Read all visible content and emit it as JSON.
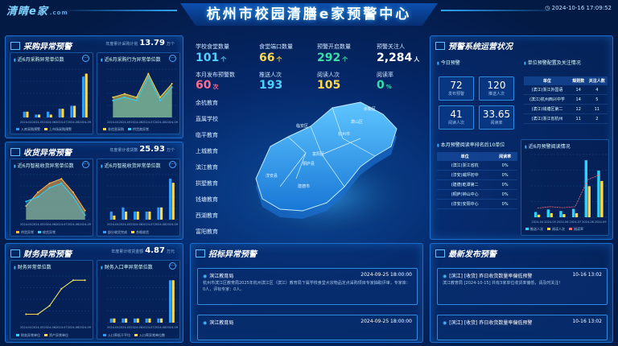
{
  "header": {
    "logo": "清睛e家",
    "logo_small": ".com",
    "title": "杭州市校园清膳e家预警中心",
    "datetime": "2024-10-16 17:09:52"
  },
  "purchase": {
    "title": "采购异常预警",
    "stat_label": "年度累计采购计划",
    "stat_value": "13.79",
    "stat_unit": "万个",
    "chart1": {
      "title": "近6月采购异常单位数",
      "legend": [
        "入库采购预警",
        "上市场采购预警"
      ]
    },
    "chart2": {
      "title": "近6月采购行为异常单位数",
      "legend": [
        "非信息采购",
        "供货商异常"
      ]
    }
  },
  "income": {
    "title": "收货异常预警",
    "stat_label": "年度累计收货数",
    "stat_value": "25.93",
    "stat_unit": "万个",
    "chart1": {
      "title": "近6月智能收货异常单位数",
      "legend": [
        "供货异常",
        "收货异常"
      ]
    },
    "chart2": {
      "title": "近6月智能收货异常单位数",
      "legend": [
        "部分收货完成",
        "合格收货"
      ]
    }
  },
  "finance": {
    "title": "财务异常预警",
    "stat_label": "年度累计收货金额",
    "stat_value": "4.87",
    "stat_unit": "万元",
    "chart1": {
      "title": "财务异常单位数",
      "legend": [
        "财务异常单位",
        "资产异常单位"
      ]
    },
    "chart2": {
      "title": "财务入口率异常单位数",
      "legend": [
        "入口率低于平均",
        "入口率异常单位数"
      ]
    }
  },
  "kpis": [
    {
      "label": "学校食堂数量",
      "value": "101",
      "unit": "个",
      "color": "#4fd1ff"
    },
    {
      "label": "食堂端口数量",
      "value": "66",
      "unit": "个",
      "color": "#ffd84a"
    },
    {
      "label": "预警开启数量",
      "value": "292",
      "unit": "个",
      "color": "#37e0a6"
    },
    {
      "label": "预警关注人",
      "value": "2,284",
      "unit": "人",
      "color": "#ffffff"
    },
    {
      "label": "本月发布预警数",
      "value": "60",
      "unit": "次",
      "color": "#ff6b8e"
    },
    {
      "label": "推送人次",
      "value": "193",
      "unit": "",
      "color": "#4fd1ff"
    },
    {
      "label": "阅读人次",
      "value": "105",
      "unit": "",
      "color": "#ffd84a"
    },
    {
      "label": "阅读率",
      "value": "0",
      "unit": "%",
      "color": "#37e0a6"
    }
  ],
  "districts": [
    "余杭教育",
    "直属学校",
    "临平教育",
    "上城教育",
    "滨江教育",
    "拱墅教育",
    "钱塘教育",
    "西湖教育",
    "富阳教育"
  ],
  "map_labels": [
    "临安区",
    "杭州市",
    "富阳区",
    "淳安县",
    "建德市",
    "萧山区",
    "桐庐县",
    "余杭区"
  ],
  "ops": {
    "title": "预警系统运营状况",
    "sub1": "今日预警",
    "sub2": "单位预警配置及关注情况",
    "boxes": [
      {
        "v": "72",
        "l": "发布预警"
      },
      {
        "v": "120",
        "l": "推送人次"
      },
      {
        "v": "41",
        "l": "阅读人次"
      },
      {
        "v": "33.65",
        "l": "阅读率"
      }
    ],
    "table1": {
      "headers": [
        "单位",
        "规则数",
        "关注人数"
      ],
      "rows": [
        [
          "(滨江)浙江外国语",
          "14",
          "4"
        ],
        [
          "(滨江)杭州西兴中学",
          "14",
          "5"
        ],
        [
          "(滨江)钱塘区第二",
          "12",
          "11"
        ],
        [
          "(滨江)浙江省杭州",
          "11",
          "2"
        ]
      ]
    },
    "table2_title": "本月预警阅读率排名后10单位",
    "table2": {
      "headers": [
        "单位",
        "阅读率"
      ],
      "rows": [
        [
          "(滨江)浙江省杭",
          "0%"
        ],
        [
          "(淳安)威坪初中",
          "0%"
        ],
        [
          "(建德)乾潭第二",
          "0%"
        ],
        [
          "(桐庐)钟山中心",
          "0%"
        ],
        [
          "(淳安)安阳中心",
          "0%"
        ]
      ]
    },
    "chart_title": "近6月预警阅读情况",
    "chart_legend": [
      "推送人次",
      "阅读人次",
      "阅读率"
    ]
  },
  "early": {
    "title": "招标异常预警",
    "items": [
      {
        "h": "滨江教育局",
        "d": "2024-09-25 18:00:00",
        "b": "杭州市滨江区教育局2025年杭州滨江区（滨江）教育局下属学校食堂大宗物品定点采购项目专家抽取评审，专家库：0人，评标专家：0人。"
      },
      {
        "h": "滨江教育局",
        "d": "2024-09-25 18:00:00",
        "b": ""
      }
    ]
  },
  "latest": {
    "title": "最新发布预警",
    "items": [
      {
        "h": "[滨江] [收货] 昨日收货数量率偏低预警",
        "d": "10-16 13:02",
        "b": "滨江教育局 [2024-10-15] 共有3家单位收货率偏低，请及时关注!"
      },
      {
        "h": "[滨江] [收货] 昨日收货数量率偏低预警",
        "d": "10-16 13:02",
        "b": ""
      }
    ]
  },
  "chart_data": [
    {
      "type": "bar",
      "title": "近6月采购异常单位数",
      "categories": [
        "2024-04",
        "2024-05",
        "2024-06",
        "2024-07",
        "2024-08",
        "2024-09"
      ],
      "series": [
        {
          "name": "入库采购预警",
          "values": [
            2,
            1,
            2,
            3,
            4,
            14
          ]
        },
        {
          "name": "上市场采购预警",
          "values": [
            2,
            1,
            1,
            3,
            4,
            15
          ]
        }
      ]
    },
    {
      "type": "area",
      "title": "近6月采购行为异常单位数",
      "categories": [
        "2024-04",
        "2024-05",
        "2024-06",
        "2024-07",
        "2024-08",
        "2024-09"
      ],
      "series": [
        {
          "name": "非信息采购",
          "values": [
            6,
            7,
            6,
            13,
            6,
            10
          ]
        },
        {
          "name": "供货商异常",
          "values": [
            5,
            6,
            5,
            12,
            5,
            9
          ]
        }
      ]
    },
    {
      "type": "area",
      "title": "近6月智能收货异常单位数",
      "categories": [
        "2024-04",
        "2024-05",
        "2024-06",
        "2024-07",
        "2024-08",
        "2024-09"
      ],
      "series": [
        {
          "name": "供货异常",
          "values": [
            3,
            6,
            8,
            9,
            6,
            2
          ]
        },
        {
          "name": "收货异常",
          "values": [
            4,
            5,
            7,
            8,
            5,
            1
          ]
        }
      ]
    },
    {
      "type": "bar",
      "title": "近6月智能收货异常单位数",
      "categories": [
        "2024-04",
        "2024-05",
        "2024-06",
        "2024-07",
        "2024-08",
        "2024-09"
      ],
      "series": [
        {
          "name": "部分收货完成",
          "values": [
            2,
            3,
            2,
            2,
            3,
            10
          ]
        },
        {
          "name": "合格收货",
          "values": [
            1,
            2,
            2,
            2,
            3,
            9
          ]
        }
      ]
    },
    {
      "type": "line",
      "title": "财务异常单位数",
      "categories": [
        "2024-04",
        "2024-05",
        "2024-06",
        "2024-07",
        "2024-08",
        "2024-09"
      ],
      "series": [
        {
          "name": "财务异常单位",
          "values": [
            1,
            1,
            2,
            4,
            5,
            5
          ]
        },
        {
          "name": "资产异常单位",
          "values": [
            1,
            1,
            2,
            4,
            5,
            5
          ]
        }
      ]
    },
    {
      "type": "bar",
      "title": "财务入口率异常单位数",
      "categories": [
        "2024-04",
        "2024-05",
        "2024-06",
        "2024-07",
        "2024-08",
        "2024-09"
      ],
      "series": [
        {
          "name": "入口率低于平均",
          "values": [
            1,
            1,
            1,
            1,
            1,
            10
          ]
        },
        {
          "name": "入口率异常单位数",
          "values": [
            1,
            1,
            1,
            1,
            1,
            10
          ]
        }
      ]
    },
    {
      "type": "bar",
      "title": "近6月预警阅读情况",
      "categories": [
        "2024-04",
        "2024-05",
        "2024-06",
        "2024-07",
        "2024-08",
        "2024-09"
      ],
      "series": [
        {
          "name": "推送人次",
          "values": [
            100,
            150,
            120,
            160,
            1100,
            900
          ]
        },
        {
          "name": "阅读人次",
          "values": [
            50,
            80,
            60,
            80,
            600,
            700
          ]
        }
      ]
    }
  ]
}
